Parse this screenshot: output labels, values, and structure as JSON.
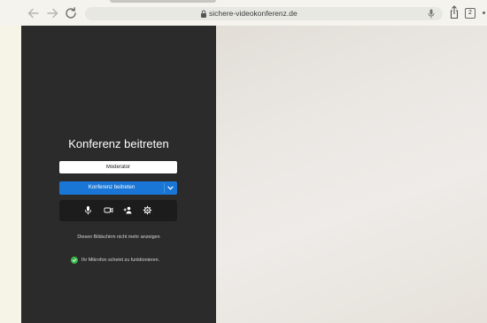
{
  "browser": {
    "url": "sichere-videokonferenz.de",
    "tab_count": "2"
  },
  "join": {
    "title": "Konferenz beitreten",
    "name_value": "Moderator",
    "join_button_label": "Konferenz beitreten",
    "hide_screen_label": "Diesen Bildschirm nicht mehr anzeigen",
    "mic_status_text": "Ihr Mikrofon scheint zu funktionieren."
  },
  "icons": {
    "back": "arrow-left-icon",
    "forward": "arrow-right-icon",
    "reload": "reload-icon",
    "lock": "lock-icon",
    "dictation": "microphone-icon",
    "share": "share-icon",
    "more": "more-icon",
    "mic": "microphone-icon",
    "camera": "camera-icon",
    "invite": "invite-people-icon",
    "settings": "gear-icon",
    "status_ok": "check-circle-icon",
    "dropdown": "chevron-down-icon"
  },
  "colors": {
    "panel_bg": "#2b2b2b",
    "primary_button": "#1976d6",
    "status_ok": "#3fb950",
    "page_bg": "#f6f3e7"
  }
}
